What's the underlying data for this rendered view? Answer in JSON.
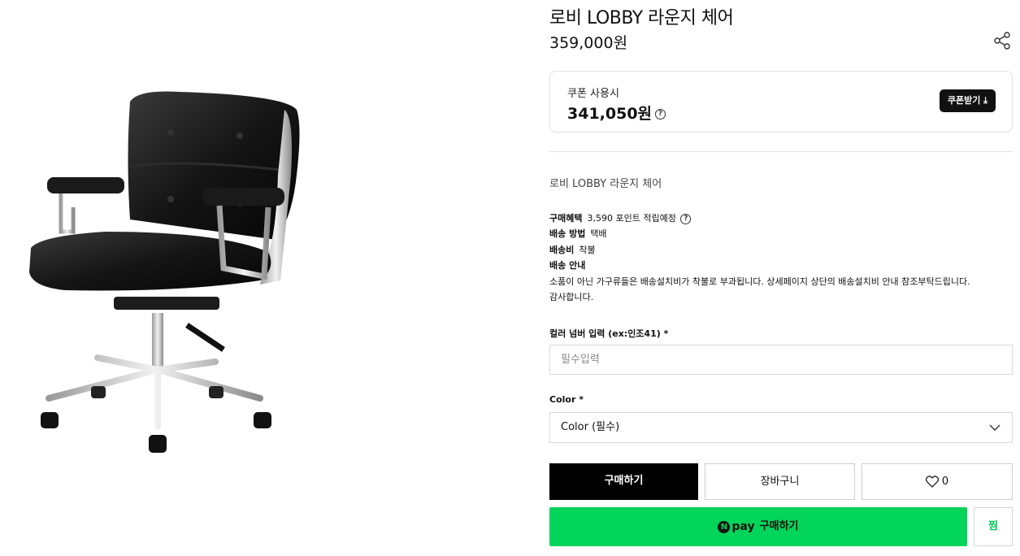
{
  "product": {
    "title": "로비 LOBBY 라운지 체어",
    "price": "359,000원",
    "image_alt": "black leather office chair"
  },
  "coupon": {
    "label": "쿠폰 사용시",
    "price": "341,050원",
    "help": "?",
    "button": "쿠폰받기 ⤓"
  },
  "subtitle": "로비 LOBBY 라운지 체어",
  "info": {
    "benefit_key": "구매혜택",
    "benefit_val": "3,590 포인트 적립예정",
    "shipping_method_key": "배송 방법",
    "shipping_method_val": "택배",
    "shipping_fee_key": "배송비",
    "shipping_fee_val": "착불",
    "shipping_guide_key": "배송 안내",
    "shipping_guide_val": "소품이 아닌 가구류들은 배송설치비가 착불로 부과됩니다. 상세페이지 상단의 배송설치비 안내 참조부탁드립니다. 감사합니다."
  },
  "form": {
    "color_number_label": "컬러 넘버 입력 (ex:인조41) *",
    "color_number_placeholder": "필수입력",
    "color_label": "Color *",
    "color_select_value": "Color (필수)"
  },
  "actions": {
    "buy": "구매하기",
    "cart": "장바구니",
    "like_count": "0",
    "npay_n": "N",
    "npay_pay": "pay",
    "npay_buy": "구매하기",
    "zzim": "찜"
  },
  "colors": {
    "npay_green": "#03d45a",
    "zzim_green": "#03c75a",
    "buy_black": "#000000"
  },
  "icons": {
    "share": "share-icon",
    "help": "question-circle-icon",
    "download": "download-arrow-icon",
    "chevron": "chevron-down-icon",
    "heart": "heart-icon"
  }
}
